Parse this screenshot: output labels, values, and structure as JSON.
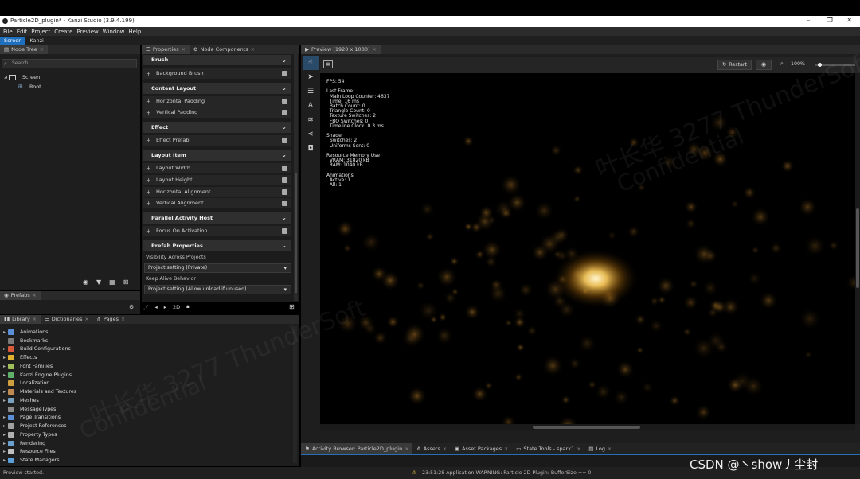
{
  "window": {
    "title": "Particle2D_plugin* - Kanzi Studio (3.9.4.199)",
    "minimize": "–",
    "restore": "❐",
    "close": "✕"
  },
  "menu": [
    "File",
    "Edit",
    "Project",
    "Create",
    "Preview",
    "Window",
    "Help"
  ],
  "workspace_tabs": [
    "Screen",
    "Kanzi"
  ],
  "node_tree": {
    "tab": "Node Tree",
    "search_placeholder": "Search...",
    "items": [
      "Screen",
      "Root"
    ]
  },
  "properties": {
    "tabs": [
      "Properties",
      "Node Components"
    ],
    "sections": [
      {
        "title": "Brush",
        "props": [
          "Background Brush"
        ]
      },
      {
        "title": "Content Layout",
        "props": [
          "Horizontal Padding",
          "Vertical Padding"
        ]
      },
      {
        "title": "Effect",
        "props": [
          "Effect Prefab"
        ]
      },
      {
        "title": "Layout Item",
        "props": [
          "Layout Width",
          "Layout Height",
          "Horizontal Alignment",
          "Vertical Alignment"
        ]
      },
      {
        "title": "Parallel Activity Host",
        "props": [
          "Focus On Activation"
        ]
      },
      {
        "title": "Prefab Properties",
        "props": []
      }
    ],
    "visibility_label": "Visibility Across Projects",
    "visibility_value": "Project setting (Private)",
    "keepalive_label": "Keep Alive Behavior",
    "keepalive_value": "Project setting (Allow unload if unused)"
  },
  "prefabs": {
    "tab": "Prefabs"
  },
  "library": {
    "tabs": [
      "Library",
      "Dictionaries",
      "Pages"
    ],
    "items": [
      {
        "label": "Animations",
        "color": "#5a8fd8"
      },
      {
        "label": "Bookmarks",
        "color": "#7a7a7a"
      },
      {
        "label": "Build Configurations",
        "color": "#d85a3a"
      },
      {
        "label": "Effects",
        "color": "#e0b030"
      },
      {
        "label": "Font Families",
        "color": "#9fbf5a"
      },
      {
        "label": "Kanzi Engine Plugins",
        "color": "#5fb06a"
      },
      {
        "label": "Localization",
        "color": "#d0a040"
      },
      {
        "label": "Materials and Textures",
        "color": "#c08a50"
      },
      {
        "label": "Meshes",
        "color": "#7aa0c0"
      },
      {
        "label": "MessageTypes",
        "color": "#8a8a8a"
      },
      {
        "label": "Page Transitions",
        "color": "#5a8fd8"
      },
      {
        "label": "Project References",
        "color": "#a0a0a0"
      },
      {
        "label": "Property Types",
        "color": "#b0b0b0"
      },
      {
        "label": "Rendering",
        "color": "#6aa0d0"
      },
      {
        "label": "Resource Files",
        "color": "#c0c0c0"
      },
      {
        "label": "State Managers",
        "color": "#5a9fd8"
      }
    ],
    "expandable": [
      true,
      false,
      true,
      true,
      true,
      true,
      false,
      true,
      true,
      false,
      true,
      true,
      true,
      true,
      true,
      true
    ]
  },
  "preview": {
    "tab": "Preview [1920 x 1080]",
    "restart_label": "Restart",
    "zoom": "100%",
    "fps_text": "FPS: 54\n\nLast Frame\n  Main Loop Counter: 4637\n  Time: 16 ms\n  Batch Count: 0\n  Triangle Count: 0\n  Texture Switches: 2\n  FBO Switches: 0\n  Timeline Clock: 0.3 ms\n\nShader\n  Switches: 2\n  Uniforms Sent: 0\n\nResource Memory Use\n  VRAM: 31820 kB\n  RAM: 1040 kB\n\nAnimations\n  Active: 1\n  All: 1"
  },
  "bottom_tabs": [
    "Activity Browser: Particle2D_plugin",
    "Assets",
    "Asset Packages",
    "State Tools - spark1",
    "Log"
  ],
  "status": {
    "left": "Preview started.",
    "warning": "23:51:28 Application WARNING: Particle 2D Plugin: BufferSize == 0"
  },
  "watermark": {
    "csdn": "CSDN @丶show丿尘封",
    "ts1": "叶长华 3277 ThunderSoft",
    "ts2": "Confidential"
  },
  "colors": {
    "accent": "#1f6fbf",
    "particle": "#f7b23b"
  }
}
